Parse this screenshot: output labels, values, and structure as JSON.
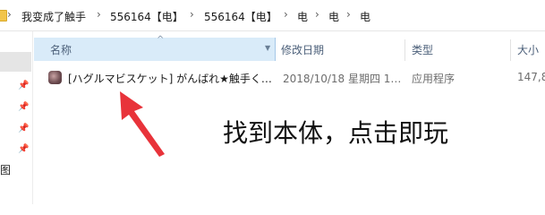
{
  "breadcrumb": {
    "items": [
      "我变成了触手",
      "556164【电】",
      "556164【电】",
      "电",
      "电",
      "电"
    ],
    "separator": "›"
  },
  "sidebar": {
    "partial_label": "图"
  },
  "columns": {
    "name": "名称",
    "modified": "修改日期",
    "type": "类型",
    "size": "大小"
  },
  "files": [
    {
      "name": "[ハグルマビスケット] がんばれ★触手く…",
      "modified": "2018/10/18 星期四 1…",
      "type": "应用程序",
      "size": "147,8"
    }
  ],
  "annotation": {
    "text": "找到本体，点击即玩",
    "arrow_color": "#e8333a"
  }
}
